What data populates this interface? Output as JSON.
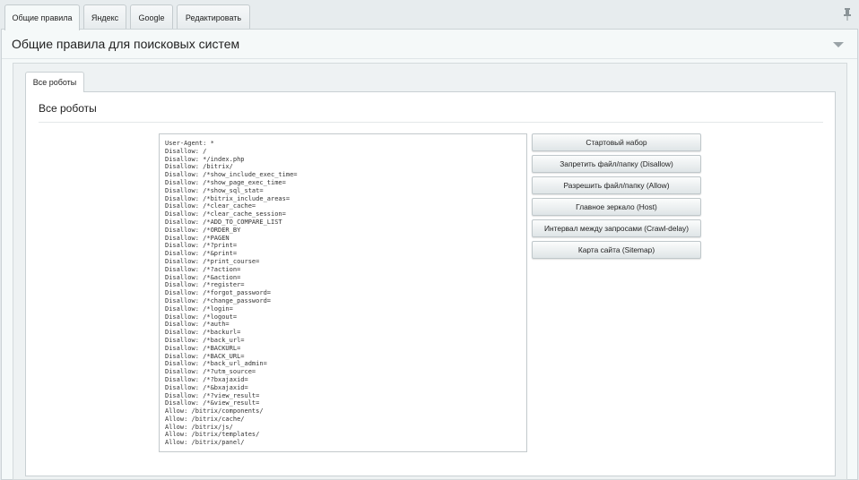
{
  "top_tabs": [
    {
      "label": "Общие правила"
    },
    {
      "label": "Яндекс"
    },
    {
      "label": "Google"
    },
    {
      "label": "Редактировать"
    }
  ],
  "panel": {
    "title": "Общие правила для поисковых систем"
  },
  "inner_tab": {
    "label": "Все роботы",
    "title": "Все роботы"
  },
  "robots_lines": [
    "User-Agent: *",
    "Disallow: /",
    "Disallow: */index.php",
    "Disallow: /bitrix/",
    "Disallow: /*show_include_exec_time=",
    "Disallow: /*show_page_exec_time=",
    "Disallow: /*show_sql_stat=",
    "Disallow: /*bitrix_include_areas=",
    "Disallow: /*clear_cache=",
    "Disallow: /*clear_cache_session=",
    "Disallow: /*ADD_TO_COMPARE_LIST",
    "Disallow: /*ORDER_BY",
    "Disallow: /*PAGEN",
    "Disallow: /*?print=",
    "Disallow: /*&print=",
    "Disallow: /*print_course=",
    "Disallow: /*?action=",
    "Disallow: /*&action=",
    "Disallow: /*register=",
    "Disallow: /*forgot_password=",
    "Disallow: /*change_password=",
    "Disallow: /*login=",
    "Disallow: /*logout=",
    "Disallow: /*auth=",
    "Disallow: /*backurl=",
    "Disallow: /*back_url=",
    "Disallow: /*BACKURL=",
    "Disallow: /*BACK_URL=",
    "Disallow: /*back_url_admin=",
    "Disallow: /*?utm_source=",
    "Disallow: /*?bxajaxid=",
    "Disallow: /*&bxajaxid=",
    "Disallow: /*?view_result=",
    "Disallow: /*&view_result=",
    "Allow: /bitrix/components/",
    "Allow: /bitrix/cache/",
    "Allow: /bitrix/js/",
    "Allow: /bitrix/templates/",
    "Allow: /bitrix/panel/"
  ],
  "buttons": [
    {
      "label": "Стартовый набор"
    },
    {
      "label": "Запретить файл/папку (Disallow)"
    },
    {
      "label": "Разрешить файл/папку (Allow)"
    },
    {
      "label": "Главное зеркало (Host)"
    },
    {
      "label": "Интервал между запросами (Crawl-delay)"
    },
    {
      "label": "Карта сайта (Sitemap)"
    }
  ],
  "icons": {
    "pin": "pin-icon",
    "collapse": "chevron-down-icon"
  },
  "colors": {
    "background": "#e4e9ec",
    "panel": "#f5f9f9",
    "border": "#c9d0d3"
  }
}
